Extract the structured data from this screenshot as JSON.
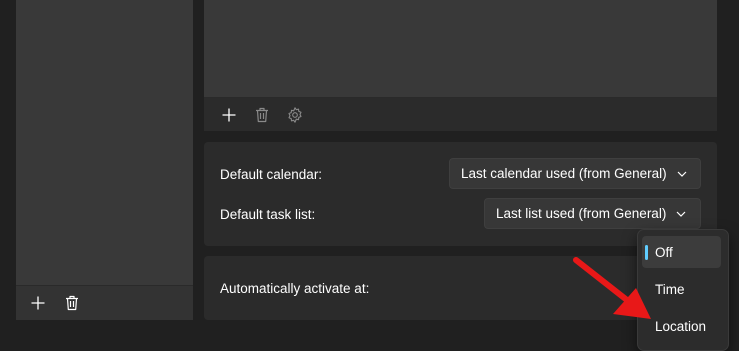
{
  "sections": {
    "defaults": {
      "calendar_label": "Default calendar:",
      "calendar_value": "Last calendar used (from General)",
      "task_list_label": "Default task list:",
      "task_list_value": "Last list used (from General)"
    },
    "activate": {
      "label": "Automatically activate at:"
    }
  },
  "activate_menu": {
    "options": [
      "Off",
      "Time",
      "Location"
    ],
    "selected": "Off"
  },
  "icons": {
    "left_toolbar": [
      "plus-icon",
      "trash-icon"
    ],
    "right_toolbar": [
      "plus-icon",
      "trash-icon",
      "gear-icon"
    ],
    "dropdown": "chevron-down-icon"
  },
  "colors": {
    "accent": "#60cdff",
    "annotation_arrow": "#e81818"
  }
}
